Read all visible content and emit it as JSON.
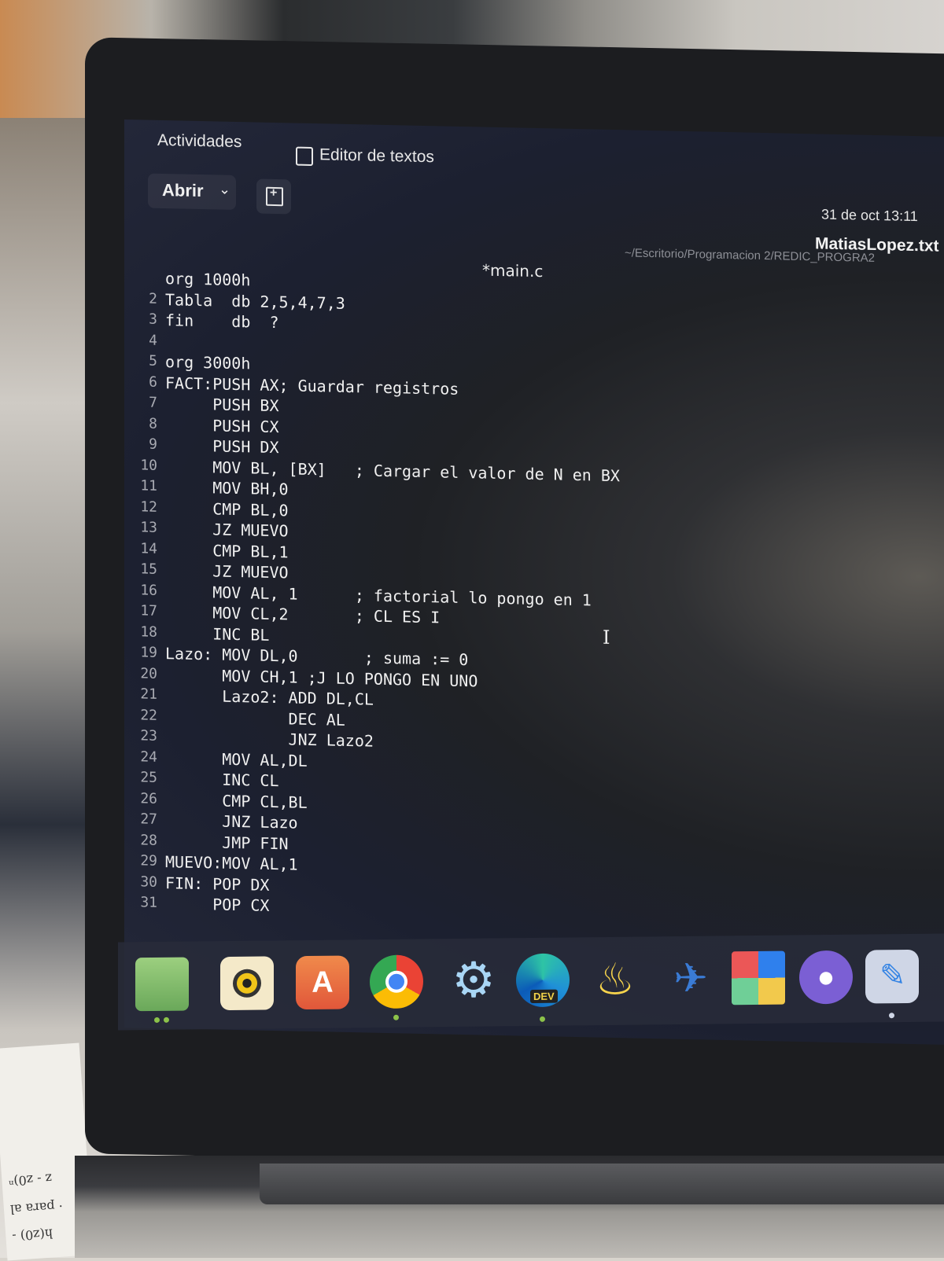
{
  "topbar": {
    "activities": "Actividades",
    "app_name": "Editor de textos",
    "clock": "31 de oct  13:11"
  },
  "header": {
    "open_label": "Abrir",
    "doc_title": "MatiasLopez.txt",
    "doc_path": "~/Escritorio/Programacion 2/REDIC_PROGRA2",
    "tab_name": "*main.c"
  },
  "code_lines": [
    {
      "n": "",
      "t": "org 1000h"
    },
    {
      "n": "2",
      "t": "Tabla  db 2,5,4,7,3"
    },
    {
      "n": "3",
      "t": "fin    db  ?"
    },
    {
      "n": "4",
      "t": ""
    },
    {
      "n": "5",
      "t": "org 3000h"
    },
    {
      "n": "6",
      "t": "FACT:PUSH AX; Guardar registros"
    },
    {
      "n": "7",
      "t": "     PUSH BX"
    },
    {
      "n": "8",
      "t": "     PUSH CX"
    },
    {
      "n": "9",
      "t": "     PUSH DX"
    },
    {
      "n": "10",
      "t": "     MOV BL, [BX]   ; Cargar el valor de N en BX"
    },
    {
      "n": "11",
      "t": "     MOV BH,0"
    },
    {
      "n": "12",
      "t": "     CMP BL,0"
    },
    {
      "n": "13",
      "t": "     JZ MUEVO"
    },
    {
      "n": "14",
      "t": "     CMP BL,1"
    },
    {
      "n": "15",
      "t": "     JZ MUEVO"
    },
    {
      "n": "16",
      "t": "     MOV AL, 1      ; factorial lo pongo en 1"
    },
    {
      "n": "17",
      "t": "     MOV CL,2       ; CL ES I"
    },
    {
      "n": "18",
      "t": "     INC BL"
    },
    {
      "n": "19",
      "t": "Lazo: MOV DL,0       ; suma := 0"
    },
    {
      "n": "20",
      "t": "      MOV CH,1 ;J LO PONGO EN UNO"
    },
    {
      "n": "21",
      "t": "      Lazo2: ADD DL,CL"
    },
    {
      "n": "22",
      "t": "             DEC AL"
    },
    {
      "n": "23",
      "t": "             JNZ Lazo2"
    },
    {
      "n": "24",
      "t": "      MOV AL,DL"
    },
    {
      "n": "25",
      "t": "      INC CL"
    },
    {
      "n": "26",
      "t": "      CMP CL,BL"
    },
    {
      "n": "27",
      "t": "      JNZ Lazo"
    },
    {
      "n": "28",
      "t": "      JMP FIN"
    },
    {
      "n": "29",
      "t": "MUEVO:MOV AL,1"
    },
    {
      "n": "30",
      "t": "FIN: POP DX"
    },
    {
      "n": "31",
      "t": "     POP CX"
    }
  ],
  "dock": {
    "items": [
      "files-icon",
      "rhythmbox-icon",
      "app-store-icon",
      "chrome-icon",
      "tweaks-icon",
      "edge-dev-icon",
      "lamp-icon",
      "bird-icon",
      "tiles-icon",
      "github-icon",
      "text-editor-icon"
    ],
    "edge_badge": "DEV"
  },
  "paper_text": [
    "h(z0) -",
    "· para al",
    "z - z0)ⁿ"
  ]
}
